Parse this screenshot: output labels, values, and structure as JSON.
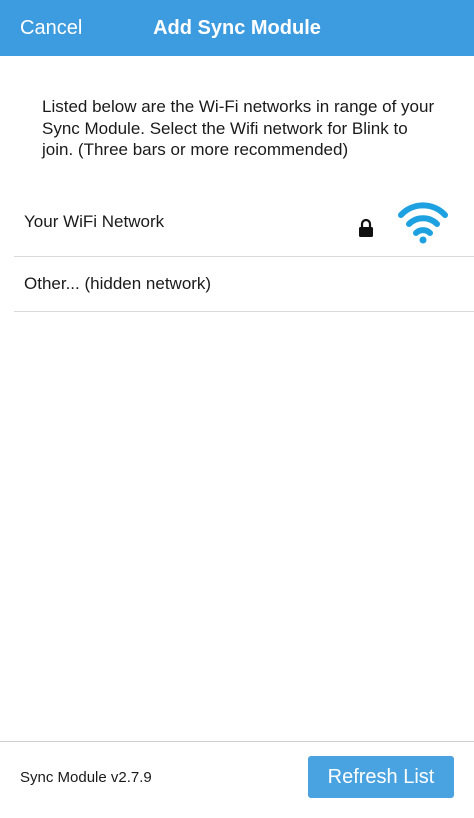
{
  "navbar": {
    "cancel_label": "Cancel",
    "title": "Add Sync Module"
  },
  "intro_text": "Listed below are the Wi-Fi networks in range of your Sync Module. Select the Wifi network for Blink to join. (Three bars or more recommended)",
  "networks": [
    {
      "label": "Your WiFi Network",
      "secured": true,
      "signal_icon": "wifi-icon",
      "lock_icon": "lock-icon"
    },
    {
      "label": "Other...  (hidden network)"
    }
  ],
  "footer": {
    "version": "Sync Module v2.7.9",
    "refresh_label": "Refresh List"
  },
  "colors": {
    "accent": "#3d9be0",
    "button": "#4aa3e1",
    "wifi_icon": "#1da1e0"
  }
}
